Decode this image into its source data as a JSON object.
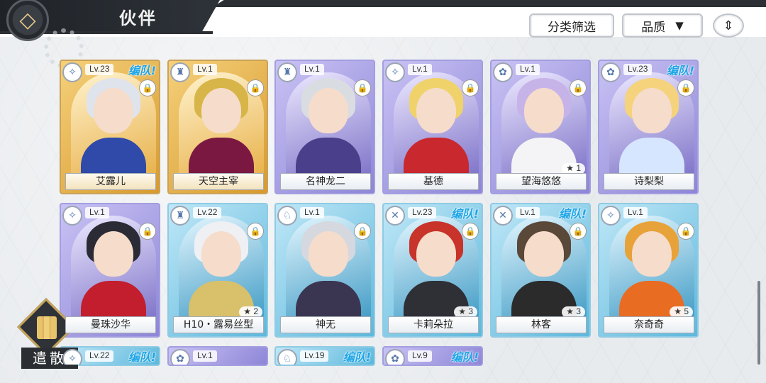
{
  "header": {
    "title": "伙伴",
    "filter_label": "分类筛选",
    "quality_label": "品质",
    "quality_arrow": "▼",
    "sort_icon": "⇕"
  },
  "team_tag": "编队!",
  "lock_glyph": "🔒",
  "star_glyph": "★",
  "dismiss_label": "遣散",
  "cards": [
    {
      "name": "艾露儿",
      "level": "Lv.23",
      "team": true,
      "stars": "",
      "rarity": "gold",
      "hair": "#dfe3ec",
      "body": "#2f4aa8",
      "role": "✧"
    },
    {
      "name": "天空主宰",
      "level": "Lv.1",
      "team": false,
      "stars": "",
      "rarity": "gold",
      "hair": "#d7b548",
      "body": "#7a1842",
      "role": "♜"
    },
    {
      "name": "名神龙二",
      "level": "Lv.1",
      "team": false,
      "stars": "",
      "rarity": "purple",
      "hair": "#d9dde2",
      "body": "#4a3f8a",
      "role": "♜"
    },
    {
      "name": "基德",
      "level": "Lv.1",
      "team": false,
      "stars": "",
      "rarity": "purple",
      "hair": "#f0d26a",
      "body": "#c8282e",
      "role": "✧"
    },
    {
      "name": "望海悠悠",
      "level": "Lv.1",
      "team": false,
      "stars": "1",
      "rarity": "purple",
      "hair": "#c6b3e8",
      "body": "#f4f4f6",
      "role": "✿"
    },
    {
      "name": "诗梨梨",
      "level": "Lv.23",
      "team": true,
      "stars": "",
      "rarity": "purple",
      "hair": "#f5d27c",
      "body": "#d6e6ff",
      "role": "✿"
    },
    {
      "name": "曼珠沙华",
      "level": "Lv.1",
      "team": false,
      "stars": "",
      "rarity": "purple",
      "hair": "#2a2b35",
      "body": "#c21e2e",
      "role": "✧"
    },
    {
      "name": "H10・露易丝型",
      "level": "Lv.22",
      "team": false,
      "stars": "2",
      "rarity": "blue",
      "hair": "#eef0f4",
      "body": "#d9c06a",
      "role": "♜"
    },
    {
      "name": "神无",
      "level": "Lv.1",
      "team": false,
      "stars": "",
      "rarity": "blue",
      "hair": "#d5d9df",
      "body": "#3a3550",
      "role": "♘"
    },
    {
      "name": "卡莉朵拉",
      "level": "Lv.23",
      "team": true,
      "stars": "3",
      "rarity": "blue",
      "hair": "#c8332a",
      "body": "#2f2f36",
      "role": "✕"
    },
    {
      "name": "林客",
      "level": "Lv.1",
      "team": true,
      "stars": "3",
      "rarity": "blue",
      "hair": "#5a4838",
      "body": "#2b2b2b",
      "role": "✕"
    },
    {
      "name": "奈奇奇",
      "level": "Lv.1",
      "team": false,
      "stars": "5",
      "rarity": "blue",
      "hair": "#e8a23a",
      "body": "#e96c23",
      "role": "✧"
    }
  ],
  "partial_cards": [
    {
      "level": "Lv.22",
      "team": true,
      "rarity": "blue",
      "role": "✧"
    },
    {
      "level": "Lv.1",
      "team": false,
      "rarity": "purple",
      "role": "✿"
    },
    {
      "level": "Lv.19",
      "team": true,
      "rarity": "blue",
      "role": "♘"
    },
    {
      "level": "Lv.9",
      "team": true,
      "rarity": "purple",
      "role": "✿"
    }
  ]
}
